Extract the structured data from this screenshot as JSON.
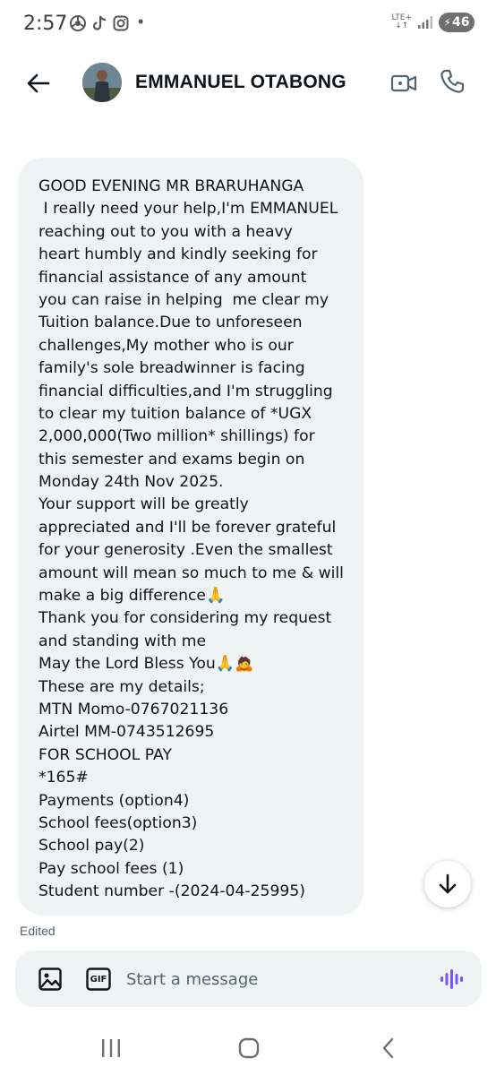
{
  "status_bar": {
    "time": "2:57",
    "network": "LTE+",
    "battery": "46",
    "icons": [
      "chrome-icon",
      "tiktok-icon",
      "instagram-icon",
      "notification-dot",
      "signal-icon",
      "battery-charging-icon"
    ]
  },
  "header": {
    "contact_name": "EMMANUEL OTABONG",
    "icons": [
      "back-arrow-icon",
      "video-call-icon",
      "phone-call-icon"
    ]
  },
  "message": {
    "lines": [
      "GOOD EVENING MR BRARUHANGA",
      " I really need your help,I'm EMMANUEL",
      "reaching out to you with a heavy",
      "heart humbly and kindly seeking for",
      "financial assistance of any amount",
      "you can raise in helping  me clear my",
      "Tuition balance.Due to unforeseen",
      "challenges,My mother who is our",
      "family's sole breadwinner is facing",
      "financial difficulties,and I'm struggling",
      "to clear my tuition balance of *UGX",
      "2,000,000(Two million* shillings) for",
      "this semester and exams begin on",
      "Monday 24th Nov 2025.",
      "Your support will be greatly",
      "appreciated and I'll be forever grateful",
      "for your generosity .Even the smallest",
      "amount will mean so much to me & will",
      "make a big difference🙏",
      "Thank you for considering my request",
      "and standing with me",
      "May the Lord Bless You🙏🙇",
      "These are my details;",
      "MTN Momo-0767021136",
      "Airtel MM-0743512695",
      "FOR SCHOOL PAY",
      "*165#",
      "Payments (option4)",
      "School fees(option3)",
      "School pay(2)",
      "Pay school fees (1)",
      "Student number -(2024-04-25995)"
    ],
    "edited_label": "Edited"
  },
  "composer": {
    "placeholder": "Start a message",
    "gif_label": "GIF"
  },
  "colors": {
    "bubble_bg": "#eff3f4",
    "text": "#0f1419",
    "muted": "#536471",
    "voice_accent": "#7856ff"
  }
}
